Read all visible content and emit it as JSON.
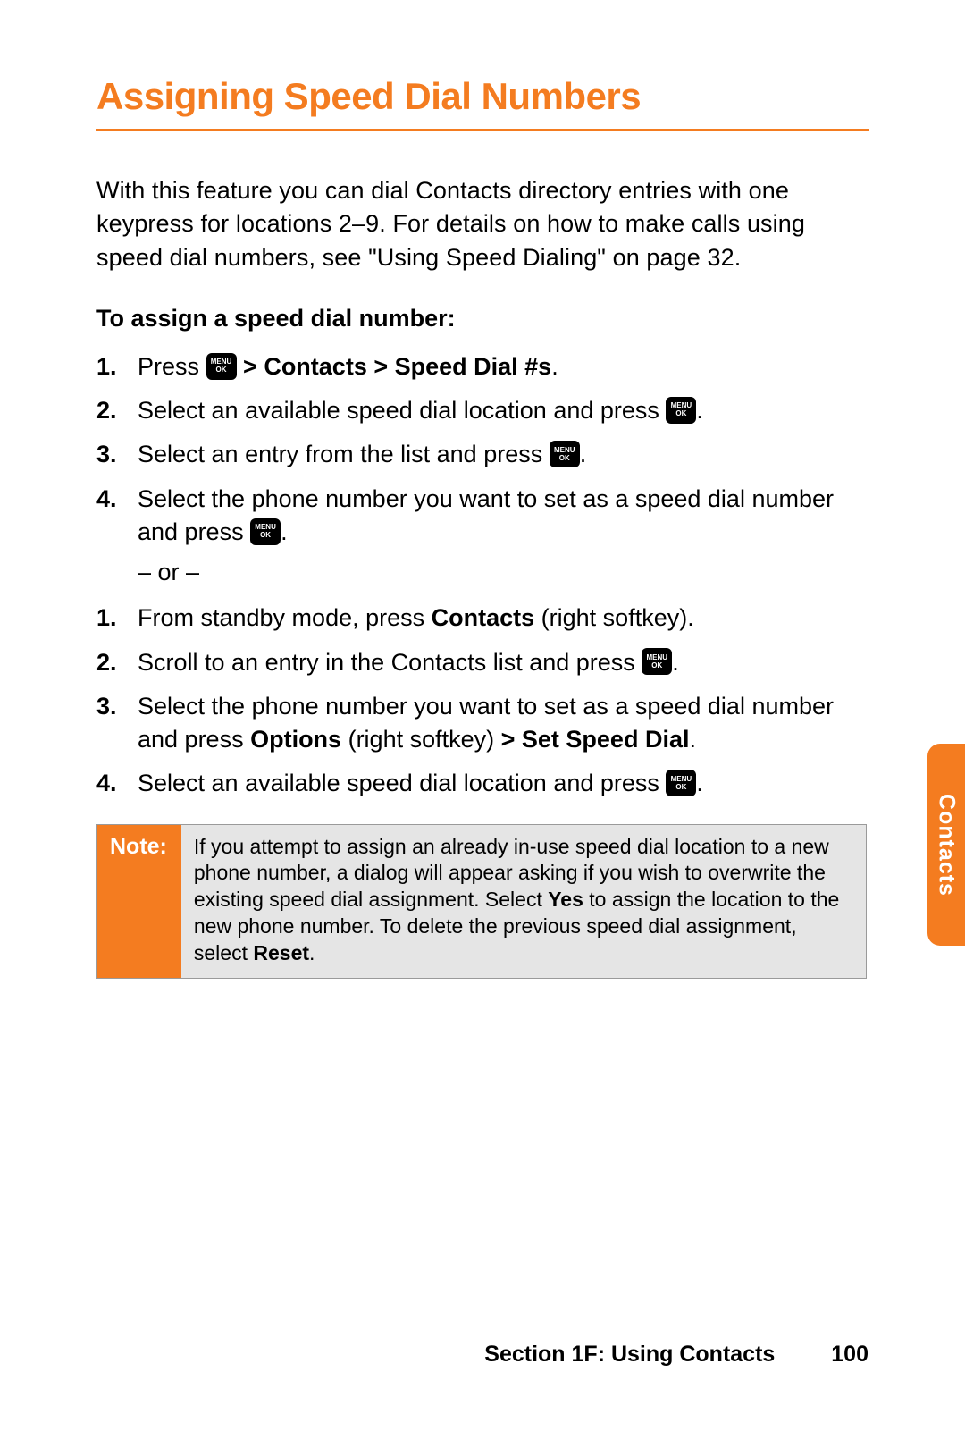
{
  "heading": "Assigning Speed Dial Numbers",
  "intro": "With this feature you can dial Contacts directory entries with one keypress for locations 2–9. For details on how to make calls using speed dial numbers, see \"Using Speed Dialing\" on page 32.",
  "subheading": "To assign a speed dial number:",
  "key": {
    "line1": "MENU",
    "line2": "OK"
  },
  "list1": {
    "n1": "1.",
    "i1a": "Press ",
    "i1b": " > Contacts > Speed Dial #s",
    "i1c": ".",
    "n2": "2.",
    "i2a": "Select an available speed dial location and press ",
    "i2b": ".",
    "n3": "3.",
    "i3a": "Select an entry from the list and press ",
    "i3b": ".",
    "n4": "4.",
    "i4a": "Select the phone number you want to set as a speed dial number and press ",
    "i4b": ".",
    "or": "– or –"
  },
  "list2": {
    "n1": "1.",
    "i1a": "From standby mode, press ",
    "i1b": "Contacts",
    "i1c": " (right softkey).",
    "n2": "2.",
    "i2a": "Scroll to an entry in the Contacts list and press ",
    "i2b": ".",
    "n3": "3.",
    "i3a": "Select the phone number you want to set as a speed dial number and press ",
    "i3b": "Options",
    "i3c": " (right softkey) ",
    "i3d": "> Set Speed Dial",
    "i3e": ".",
    "n4": "4.",
    "i4a": "Select an available speed dial location and press ",
    "i4b": "."
  },
  "note": {
    "label": "Note:",
    "t1": "If you attempt to assign an already in-use speed dial location to a new phone number, a dialog will appear asking if you wish to overwrite the existing speed dial assignment. Select ",
    "yes": "Yes",
    "t2": " to assign the location to the new phone number. To delete the previous speed dial assignment, select ",
    "reset": "Reset",
    "t3": "."
  },
  "sideTab": "Contacts",
  "footer": {
    "section": "Section 1F: Using Contacts",
    "page": "100"
  }
}
